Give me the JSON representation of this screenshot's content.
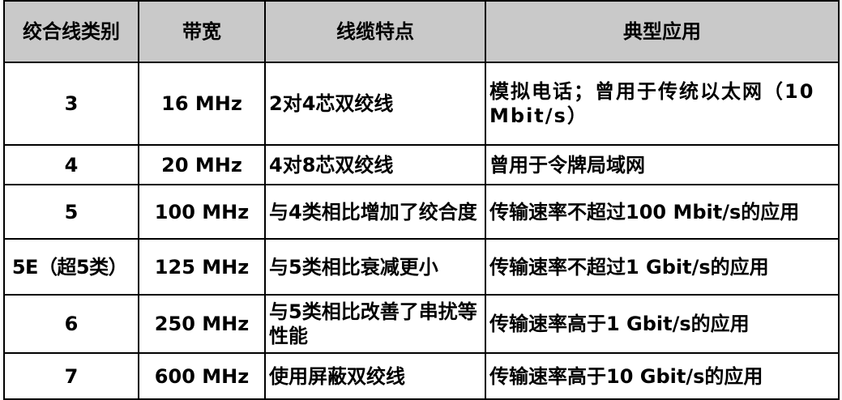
{
  "table": {
    "headers": [
      "绞合线类别",
      "带宽",
      "线缆特点",
      "典型应用"
    ],
    "rows": [
      {
        "category": "3",
        "bandwidth": "16 MHz",
        "feature": "2对4芯双绞线",
        "application": "模拟电话；曾用于传统以太网（10 Mbit/s）"
      },
      {
        "category": "4",
        "bandwidth": "20 MHz",
        "feature": "4对8芯双绞线",
        "application": "曾用于令牌局域网"
      },
      {
        "category": "5",
        "bandwidth": "100 MHz",
        "feature": "与4类相比增加了绞合度",
        "application": "传输速率不超过100  Mbit/s的应用"
      },
      {
        "category": "5E（超5类）",
        "bandwidth": "125 MHz",
        "feature": "与5类相比衰减更小",
        "application": "传输速率不超过1 Gbit/s的应用"
      },
      {
        "category": "6",
        "bandwidth": "250 MHz",
        "feature": "与5类相比改善了串扰等性能",
        "application": "传输速率高于1 Gbit/s的应用"
      },
      {
        "category": "7",
        "bandwidth": "600 MHz",
        "feature": "使用屏蔽双绞线",
        "application": "传输速率高于10 Gbit/s的应用"
      }
    ]
  },
  "colors": {
    "header_bg": "#c9c9c9",
    "border": "#000000",
    "text": "#000000"
  }
}
